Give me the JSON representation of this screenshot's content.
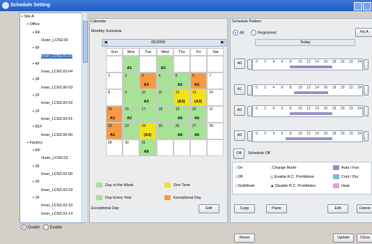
{
  "window": {
    "title": "Schedule Setting"
  },
  "tree": {
    "items": [
      {
        "label": "Site A",
        "level": 0
      },
      {
        "label": "Office",
        "level": 1
      },
      {
        "label": "RF",
        "level": 2
      },
      {
        "label": "Outer_LCN2.00",
        "level": 3
      },
      {
        "label": "5F",
        "level": 2
      },
      {
        "label": "Inner_LCN2.01-03",
        "level": 3
      },
      {
        "label": "4F",
        "level": 2
      },
      {
        "label": "Inner_LCN2.02-04",
        "level": 3
      },
      {
        "label": "3F",
        "level": 2
      },
      {
        "label": "Inner_LCN2.00-03",
        "level": 3
      },
      {
        "label": "2F",
        "level": 2
      },
      {
        "label": "Inner_LCN2.00-02",
        "level": 3
      },
      {
        "label": "1F",
        "level": 2
      },
      {
        "label": "Inner_LCN2.00-01",
        "level": 3
      },
      {
        "label": "B1F",
        "level": 2
      },
      {
        "label": "Inner_LCN2.00-00",
        "level": 3
      },
      {
        "label": "Factory",
        "level": 1
      },
      {
        "label": "RF",
        "level": 2
      },
      {
        "label": "Outer_LCN2.02",
        "level": 3
      },
      {
        "label": "3F",
        "level": 2
      },
      {
        "label": "Inner_LCN2.02-00",
        "level": 3
      },
      {
        "label": "2F",
        "level": 2
      },
      {
        "label": "Inner_LCN2.02-03",
        "level": 3
      },
      {
        "label": "1F",
        "level": 2
      },
      {
        "label": "Inner_LCN2.02-10",
        "level": 3
      },
      {
        "label": "Inner_LCN2.02-14",
        "level": 3
      }
    ],
    "selected_index": 5
  },
  "bottom_left": {
    "double_label": "Double",
    "enable_label": "Enable"
  },
  "calendar": {
    "title": "Calendar",
    "subtitle": "Monthly Schedule",
    "month": "05/2009",
    "weekdays": [
      "Sun",
      "Mon",
      "Tue",
      "Wed",
      "Thu",
      "Fri",
      "Sat"
    ],
    "weeks": [
      [
        {
          "d": ""
        },
        {
          "d": "",
          "c": "A1",
          "t": "g"
        },
        {
          "d": "",
          "t": "w"
        },
        {
          "d": "",
          "c": "A2",
          "t": "g"
        },
        {
          "d": "",
          "t": "w"
        },
        {
          "d": "",
          "t": "w"
        },
        {
          "d": "",
          "t": "w"
        }
      ],
      [
        {
          "d": "1",
          "t": "w"
        },
        {
          "d": "2",
          "t": "g"
        },
        {
          "d": "3",
          "c": "A3",
          "t": "o"
        },
        {
          "d": "4",
          "t": "g"
        },
        {
          "d": "5",
          "c": "A2",
          "t": "g"
        },
        {
          "d": "6",
          "c": "A2",
          "t": "o"
        },
        {
          "d": "7",
          "t": "w"
        }
      ],
      [
        {
          "d": "8",
          "t": "w"
        },
        {
          "d": "9",
          "t": "g"
        },
        {
          "d": "10",
          "c": "A3",
          "t": "g"
        },
        {
          "d": "11",
          "t": "g"
        },
        {
          "d": "12",
          "c": "(A3)",
          "t": "y"
        },
        {
          "d": "13",
          "c": "(A3)",
          "t": "y"
        },
        {
          "d": "14",
          "t": "w"
        }
      ],
      [
        {
          "d": "15",
          "c": "A1",
          "t": "o"
        },
        {
          "d": "16",
          "c": "A2",
          "t": "g"
        },
        {
          "d": "17",
          "t": "g"
        },
        {
          "d": "18",
          "t": "g"
        },
        {
          "d": "19",
          "c": "A8",
          "t": "g"
        },
        {
          "d": "20",
          "c": "A6",
          "t": "g"
        },
        {
          "d": "21",
          "t": "w"
        }
      ],
      [
        {
          "d": "22",
          "c": "A1",
          "t": "o"
        },
        {
          "d": "23",
          "t": "g"
        },
        {
          "d": "24",
          "c": "(A3)",
          "t": "y"
        },
        {
          "d": "25",
          "t": "g"
        },
        {
          "d": "26",
          "c": "A8",
          "t": "g"
        },
        {
          "d": "27",
          "c": "A6",
          "t": "g"
        },
        {
          "d": "28",
          "t": "w"
        }
      ],
      [
        {
          "d": "29",
          "t": "w"
        },
        {
          "d": "30",
          "t": "w"
        },
        {
          "d": "31",
          "c": "A8",
          "t": "g"
        },
        {
          "d": "",
          "t": "w"
        },
        {
          "d": "",
          "t": "w"
        },
        {
          "d": "",
          "t": "w"
        },
        {
          "d": "",
          "t": "w"
        }
      ]
    ],
    "legend": [
      {
        "label": "Day of the Week",
        "color": "#a6e394"
      },
      {
        "label": "One Time",
        "color": "#f2e21a"
      },
      {
        "label": "Day Every Year",
        "color": "#a6e394"
      },
      {
        "label": "Exceptional Day",
        "color": "#f59a42"
      }
    ],
    "exceptional_label": "Exceptional Day",
    "edit_label": "Edit"
  },
  "pattern": {
    "title": "Schedule Pattern",
    "all_label": "All",
    "registered_label": "Registered",
    "no_label": "No.A",
    "today_label": "Today",
    "ticks": [
      "0",
      "2",
      "4",
      "6",
      "8",
      "10",
      "12",
      "14",
      "16",
      "18",
      "20",
      "22",
      "24"
    ],
    "rows": [
      "A0",
      "A1",
      "A2",
      "A3"
    ],
    "off_code": "Off",
    "off_text": "Schedule Off"
  },
  "legend2": {
    "on": "On",
    "off": "Off",
    "onmode": "On&Mode",
    "change_mode": "Change Mode",
    "enable": "Enable R.C. Prohibition",
    "disable": "Disable R.C. Prohibition",
    "auto_fan": "Auto / Fan",
    "cool_dry": "Cool / Dry",
    "heat": "Heat",
    "colors": {
      "auto": "#9a8fc8",
      "cool": "#78b8e0",
      "heat": "#e8a0c8"
    }
  },
  "buttons": {
    "copy": "Copy",
    "paste": "Paste",
    "edit": "Edit",
    "delete": "Delete",
    "reset": "Reset",
    "update": "Update",
    "close": "Close"
  },
  "colors": {
    "green": "#a6e394",
    "orange": "#f59a42",
    "yellow": "#f2e21a",
    "title": "#2b64cf"
  }
}
